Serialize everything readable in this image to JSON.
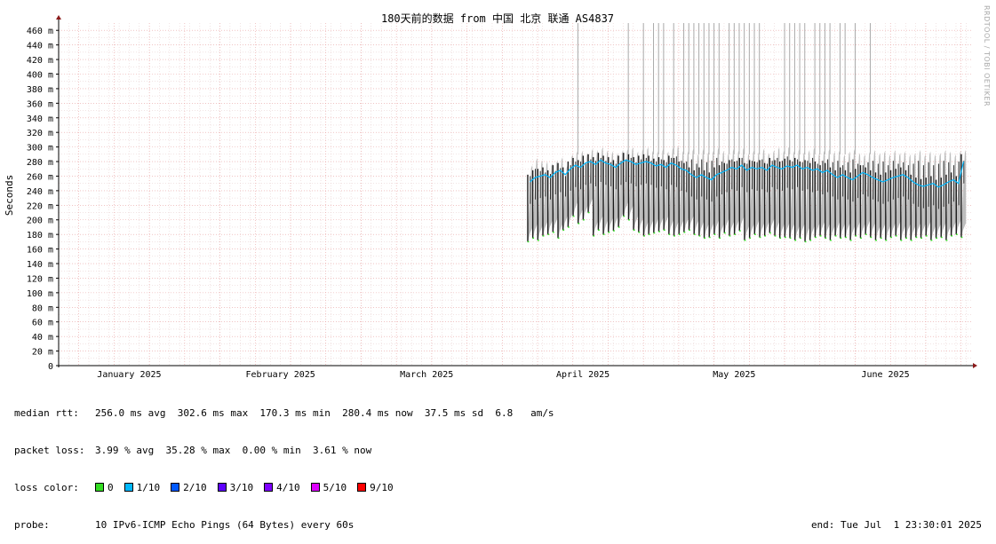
{
  "title": "180天前的数据 from 中国 北京 联通 AS4837",
  "watermark": "RRDTOOL / TOBI OETIKER",
  "stats": {
    "median_label": "median rtt:",
    "median_values": "256.0 ms avg  302.6 ms max  170.3 ms min  280.4 ms now  37.5 ms sd  6.8   am/s",
    "loss_label": "packet loss:",
    "loss_values": "3.99 % avg  35.28 % max  0.00 % min  3.61 % now",
    "color_label": "loss color:",
    "probe_label": "probe:",
    "probe_values": "10 IPv6-ICMP Echo Pings (64 Bytes) every 60s",
    "end": "end: Tue Jul  1 23:30:01 2025"
  },
  "loss_colors": [
    {
      "label": "0",
      "color": "#33dd22"
    },
    {
      "label": "1/10",
      "color": "#00b8ff"
    },
    {
      "label": "2/10",
      "color": "#0059ff"
    },
    {
      "label": "3/10",
      "color": "#5e00ff"
    },
    {
      "label": "4/10",
      "color": "#7e00ff"
    },
    {
      "label": "5/10",
      "color": "#dd00ff"
    },
    {
      "label": "9/10",
      "color": "#ff0000"
    }
  ],
  "chart_data": {
    "type": "line",
    "title": "180天前的数据 from 中国 北京 联通 AS4837",
    "ylabel": "Seconds",
    "xlabel": "",
    "ylim": [
      0,
      470
    ],
    "yticks": [
      0,
      20,
      40,
      60,
      80,
      100,
      120,
      140,
      160,
      180,
      200,
      220,
      240,
      260,
      280,
      300,
      320,
      340,
      360,
      380,
      400,
      420,
      440,
      460
    ],
    "ytick_labels": [
      "0",
      "20 m",
      "40 m",
      "60 m",
      "80 m",
      "100 m",
      "120 m",
      "140 m",
      "160 m",
      "180 m",
      "200 m",
      "220 m",
      "240 m",
      "260 m",
      "280 m",
      "300 m",
      "320 m",
      "340 m",
      "360 m",
      "380 m",
      "400 m",
      "420 m",
      "440 m",
      "460 m"
    ],
    "xlim": [
      "2025-01-02",
      "2025-07-01"
    ],
    "xticks": [
      {
        "label": "January 2025",
        "date": "2025-01-16"
      },
      {
        "label": "February 2025",
        "date": "2025-02-15"
      },
      {
        "label": "March 2025",
        "date": "2025-03-16"
      },
      {
        "label": "April 2025",
        "date": "2025-04-16"
      },
      {
        "label": "May 2025",
        "date": "2025-05-16"
      },
      {
        "label": "June 2025",
        "date": "2025-06-15"
      }
    ],
    "grid": true,
    "series": [
      {
        "name": "median rtt",
        "data_start": "2025-04-05",
        "data_end": "2025-07-01",
        "daily_min": [
          170,
          175,
          172,
          178,
          180,
          183,
          175,
          186,
          190,
          205,
          195,
          200,
          210,
          178,
          186,
          180,
          183,
          185,
          190,
          205,
          200,
          186,
          183,
          178,
          180,
          182,
          184,
          186,
          180,
          178,
          180,
          183,
          186,
          180,
          178,
          175,
          176,
          180,
          175,
          182,
          178,
          180,
          185,
          172,
          175,
          180,
          176,
          178,
          182,
          178,
          175,
          176,
          175,
          172,
          175,
          170,
          172,
          176,
          178,
          175,
          172,
          178,
          175,
          176,
          172,
          178,
          175,
          180,
          176,
          172,
          175,
          172,
          176,
          178,
          172,
          175,
          172,
          176,
          175,
          178,
          172,
          175,
          176,
          172,
          178,
          180,
          176
        ],
        "daily_max": [
          275,
          285,
          282,
          280,
          278,
          282,
          286,
          275,
          290,
          295,
          295,
          292,
          298,
          296,
          300,
          296,
          294,
          292,
          296,
          298,
          300,
          294,
          298,
          300,
          296,
          295,
          298,
          294,
          300,
          302,
          296,
          295,
          298,
          292,
          298,
          294,
          296,
          300,
          295,
          292,
          298,
          296,
          300,
          292,
          296,
          294,
          298,
          292,
          296,
          300,
          296,
          302,
          295,
          298,
          294,
          296,
          300,
          292,
          296,
          298,
          294,
          296,
          290,
          294,
          298,
          292,
          290,
          294,
          296,
          292,
          295,
          290,
          296,
          292,
          294,
          290,
          292,
          296,
          290,
          294,
          290,
          292,
          296,
          294,
          290,
          295,
          296
        ],
        "daily_median": [
          252,
          258,
          260,
          262,
          258,
          265,
          268,
          262,
          270,
          275,
          272,
          278,
          280,
          276,
          282,
          278,
          276,
          272,
          278,
          282,
          280,
          276,
          278,
          280,
          278,
          274,
          276,
          272,
          278,
          275,
          270,
          268,
          262,
          258,
          262,
          258,
          255,
          262,
          265,
          268,
          272,
          270,
          275,
          268,
          272,
          270,
          272,
          268,
          275,
          272,
          270,
          274,
          272,
          275,
          270,
          272,
          268,
          270,
          265,
          268,
          262,
          258,
          262,
          258,
          255,
          260,
          265,
          262,
          258,
          255,
          252,
          255,
          258,
          260,
          262,
          258,
          252,
          248,
          246,
          248,
          250,
          245,
          248,
          252,
          255,
          250,
          280
        ]
      }
    ],
    "loss_spike_dates": [
      "2025-04-15",
      "2025-04-25",
      "2025-04-28",
      "2025-04-30",
      "2025-05-01",
      "2025-05-02",
      "2025-05-04",
      "2025-05-06",
      "2025-05-07",
      "2025-05-08",
      "2025-05-09",
      "2025-05-10",
      "2025-05-11",
      "2025-05-12",
      "2025-05-13",
      "2025-05-15",
      "2025-05-16",
      "2025-05-17",
      "2025-05-18",
      "2025-05-19",
      "2025-05-20",
      "2025-05-21",
      "2025-05-26",
      "2025-05-27",
      "2025-05-28",
      "2025-05-29",
      "2025-05-30",
      "2025-06-01",
      "2025-06-02",
      "2025-06-03",
      "2025-06-04",
      "2025-06-06",
      "2025-06-07",
      "2025-06-09",
      "2025-06-12"
    ]
  }
}
